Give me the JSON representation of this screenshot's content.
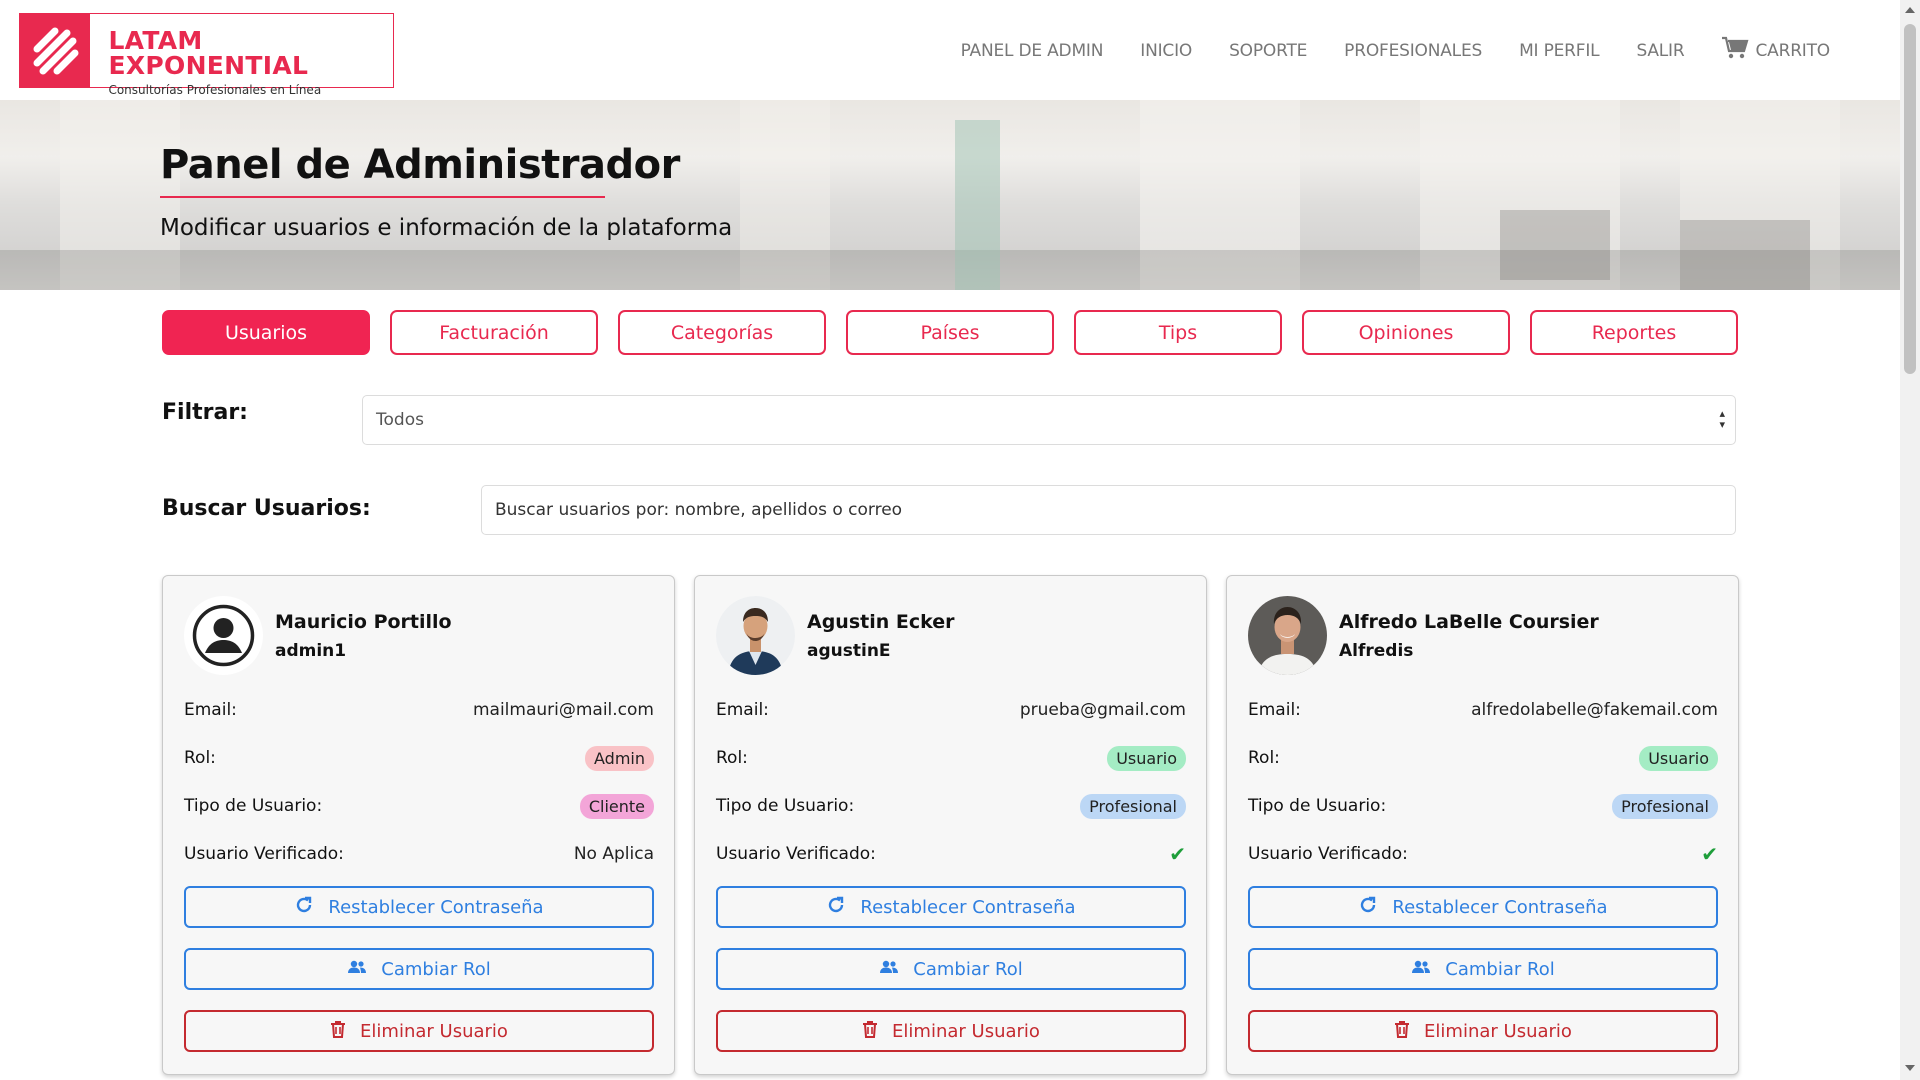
{
  "brand": {
    "name": "LATAM EXPONENTIAL",
    "tagline": "Consultorías Profesionales en Línea"
  },
  "nav": {
    "items": [
      "PANEL DE ADMIN",
      "INICIO",
      "SOPORTE",
      "PROFESIONALES",
      "MI PERFIL",
      "SALIR"
    ],
    "cart_label": "CARRITO"
  },
  "hero": {
    "title": "Panel de Administrador",
    "subtitle": "Modificar usuarios e información de la plataforma"
  },
  "tabs": [
    "Usuarios",
    "Facturación",
    "Categorías",
    "Países",
    "Tips",
    "Opiniones",
    "Reportes"
  ],
  "active_tab": "Usuarios",
  "filter": {
    "label": "Filtrar:",
    "value": "Todos"
  },
  "search": {
    "label": "Buscar Usuarios:",
    "placeholder": "Buscar usuarios por: nombre, apellidos o correo"
  },
  "field_labels": {
    "email": "Email:",
    "rol": "Rol:",
    "tipo": "Tipo de Usuario:",
    "verificado": "Usuario Verificado:"
  },
  "actions": {
    "reset": "Restablecer Contraseña",
    "role": "Cambiar Rol",
    "delete": "Eliminar Usuario"
  },
  "users": [
    {
      "name": "Mauricio Portillo",
      "username": "admin1",
      "email": "mailmauri@mail.com",
      "rol": "Admin",
      "tipo": "Cliente",
      "verificado": "No Aplica",
      "avatar": "default-user-icon"
    },
    {
      "name": "Agustin Ecker",
      "username": "agustinE",
      "email": "prueba@gmail.com",
      "rol": "Usuario",
      "tipo": "Profesional",
      "verificado": "✔",
      "avatar": "photo-man-suit"
    },
    {
      "name": "Alfredo LaBelle Coursier",
      "username": "Alfredis",
      "email": "alfredolabelle@fakemail.com",
      "rol": "Usuario",
      "tipo": "Profesional",
      "verificado": "✔",
      "avatar": "photo-man-smiling"
    }
  ],
  "colors": {
    "accent": "#e8294f",
    "primary": "#2f7fe0",
    "danger": "#c42a30",
    "verified": "#1e9e3a"
  }
}
